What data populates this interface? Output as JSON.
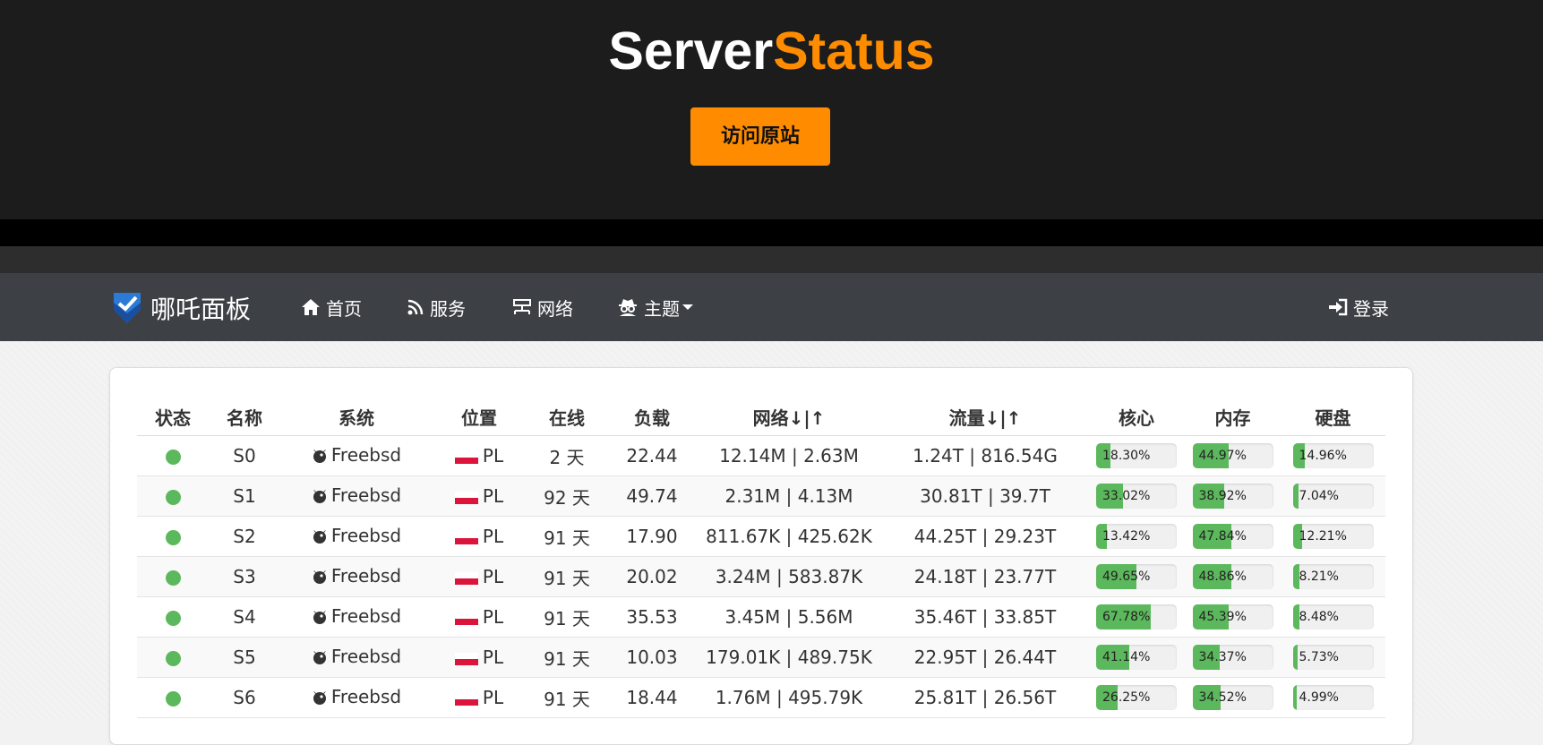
{
  "hero": {
    "title_part1": "Server",
    "title_part2": "Status",
    "visit_button": "访问原站",
    "accent_color": "#ff8c00"
  },
  "navbar": {
    "brand": "哪吒面板",
    "items": [
      {
        "label": "首页",
        "icon": "home-icon"
      },
      {
        "label": "服务",
        "icon": "rss-icon"
      },
      {
        "label": "网络",
        "icon": "network-icon"
      },
      {
        "label": "主题",
        "icon": "user-secret-icon"
      }
    ],
    "login": {
      "label": "登录",
      "icon": "sign-in-icon"
    }
  },
  "table": {
    "headers": [
      "状态",
      "名称",
      "系统",
      "位置",
      "在线",
      "负载",
      "网络↓|↑",
      "流量↓|↑",
      "核心",
      "内存",
      "硬盘"
    ],
    "rows": [
      {
        "status": "online",
        "name": "S0",
        "os": "Freebsd",
        "location": "PL",
        "uptime": "2 天",
        "load": "22.44",
        "network": "12.14M | 2.63M",
        "traffic": "1.24T | 816.54G",
        "cpu": "18.30%",
        "mem": "44.97%",
        "disk": "14.96%"
      },
      {
        "status": "online",
        "name": "S1",
        "os": "Freebsd",
        "location": "PL",
        "uptime": "92 天",
        "load": "49.74",
        "network": "2.31M | 4.13M",
        "traffic": "30.81T | 39.7T",
        "cpu": "33.02%",
        "mem": "38.92%",
        "disk": "7.04%"
      },
      {
        "status": "online",
        "name": "S2",
        "os": "Freebsd",
        "location": "PL",
        "uptime": "91 天",
        "load": "17.90",
        "network": "811.67K | 425.62K",
        "traffic": "44.25T | 29.23T",
        "cpu": "13.42%",
        "mem": "47.84%",
        "disk": "12.21%"
      },
      {
        "status": "online",
        "name": "S3",
        "os": "Freebsd",
        "location": "PL",
        "uptime": "91 天",
        "load": "20.02",
        "network": "3.24M | 583.87K",
        "traffic": "24.18T | 23.77T",
        "cpu": "49.65%",
        "mem": "48.86%",
        "disk": "8.21%"
      },
      {
        "status": "online",
        "name": "S4",
        "os": "Freebsd",
        "location": "PL",
        "uptime": "91 天",
        "load": "35.53",
        "network": "3.45M | 5.56M",
        "traffic": "35.46T | 33.85T",
        "cpu": "67.78%",
        "mem": "45.39%",
        "disk": "8.48%"
      },
      {
        "status": "online",
        "name": "S5",
        "os": "Freebsd",
        "location": "PL",
        "uptime": "91 天",
        "load": "10.03",
        "network": "179.01K | 489.75K",
        "traffic": "22.95T | 26.44T",
        "cpu": "41.14%",
        "mem": "34.37%",
        "disk": "5.73%"
      },
      {
        "status": "online",
        "name": "S6",
        "os": "Freebsd",
        "location": "PL",
        "uptime": "91 天",
        "load": "18.44",
        "network": "1.76M | 495.79K",
        "traffic": "25.81T | 26.56T",
        "cpu": "26.25%",
        "mem": "34.52%",
        "disk": "4.99%"
      }
    ]
  },
  "colors": {
    "online": "#5cb85c",
    "bar_fill": "#5cb85c",
    "navbar": "#3d4045",
    "hero_bg": "#1c1c1c"
  }
}
